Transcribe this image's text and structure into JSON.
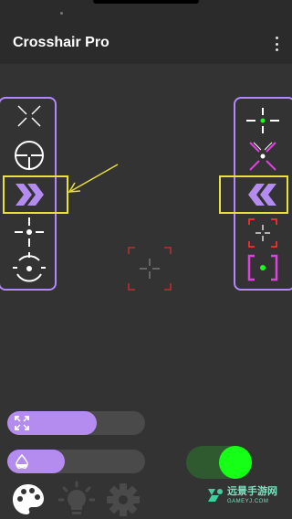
{
  "app": {
    "title": "Crosshair Pro"
  },
  "menu": {
    "icon": "more-vert-icon"
  },
  "left_panel": {
    "items": [
      {
        "icon": "x-crosshair-icon"
      },
      {
        "icon": "scope-circle-crosshair-icon"
      },
      {
        "icon": "chevron-right-double-icon",
        "selected": true
      },
      {
        "icon": "dot-cross-crosshair-icon"
      },
      {
        "icon": "circle-dot-crosshair-icon"
      }
    ]
  },
  "right_panel": {
    "items": [
      {
        "icon": "green-dot-cross-icon"
      },
      {
        "icon": "magenta-x-dot-icon"
      },
      {
        "icon": "chevron-left-double-icon",
        "selected": true
      },
      {
        "icon": "red-bracket-cross-icon"
      },
      {
        "icon": "magenta-bracket-green-dot-icon"
      }
    ]
  },
  "sliders": {
    "size": {
      "icon": "expand-icon",
      "value_percent": 65
    },
    "opacity": {
      "icon": "opacity-drop-icon",
      "value_percent": 42
    }
  },
  "toggle": {
    "enabled": true
  },
  "bottom_nav": [
    {
      "icon": "palette-icon"
    },
    {
      "icon": "lightbulb-icon"
    },
    {
      "icon": "gear-icon"
    }
  ],
  "watermark": {
    "cn": "远景手游网",
    "en": "GAMEYJ.COM"
  },
  "colors": {
    "accent": "#b48cf0",
    "highlight": "#e8e23a",
    "toggle_on": "#16ff16"
  }
}
